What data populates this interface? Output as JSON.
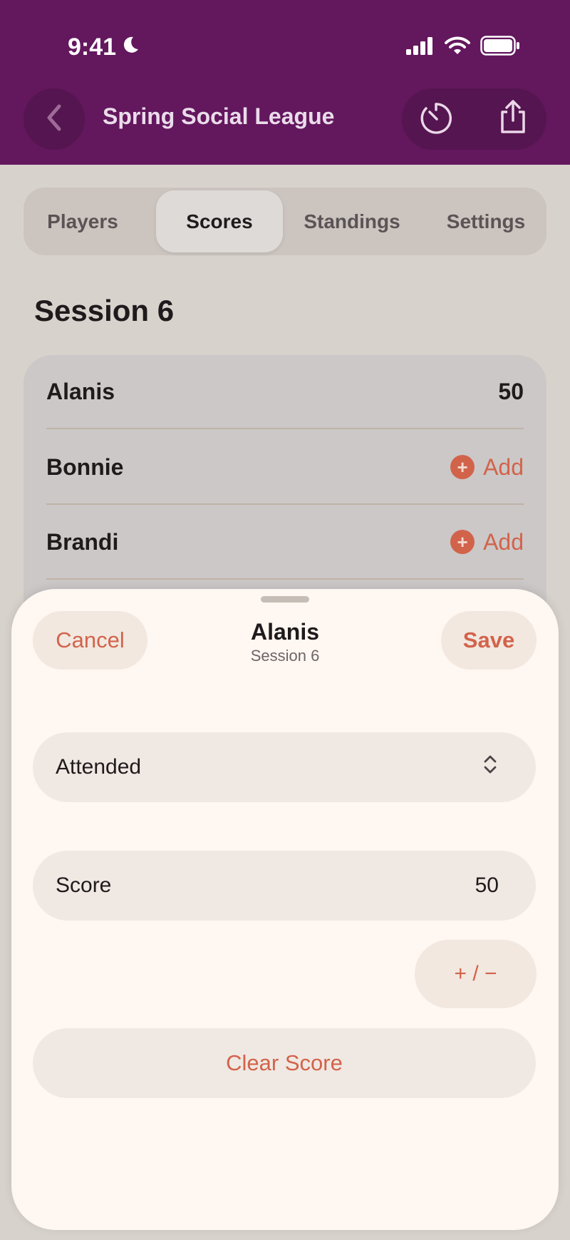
{
  "status_bar": {
    "time": "9:41"
  },
  "header": {
    "title": "Spring Social League"
  },
  "tabs": [
    {
      "label": "Players",
      "active": false
    },
    {
      "label": "Scores",
      "active": true
    },
    {
      "label": "Standings",
      "active": false
    },
    {
      "label": "Settings",
      "active": false
    }
  ],
  "section": {
    "title": "Session 6"
  },
  "players": [
    {
      "name": "Alanis",
      "score": "50"
    },
    {
      "name": "Bonnie",
      "action": "Add"
    },
    {
      "name": "Brandi",
      "action": "Add"
    }
  ],
  "sheet": {
    "cancel_label": "Cancel",
    "save_label": "Save",
    "title": "Alanis",
    "subtitle": "Session 6",
    "attendance_value": "Attended",
    "score_label": "Score",
    "score_value": "50",
    "sign_toggle_label": "+ / −",
    "clear_label": "Clear Score"
  },
  "colors": {
    "brand": "#63175d",
    "accent": "#d2634b",
    "sheet_bg": "#fff7f1"
  }
}
